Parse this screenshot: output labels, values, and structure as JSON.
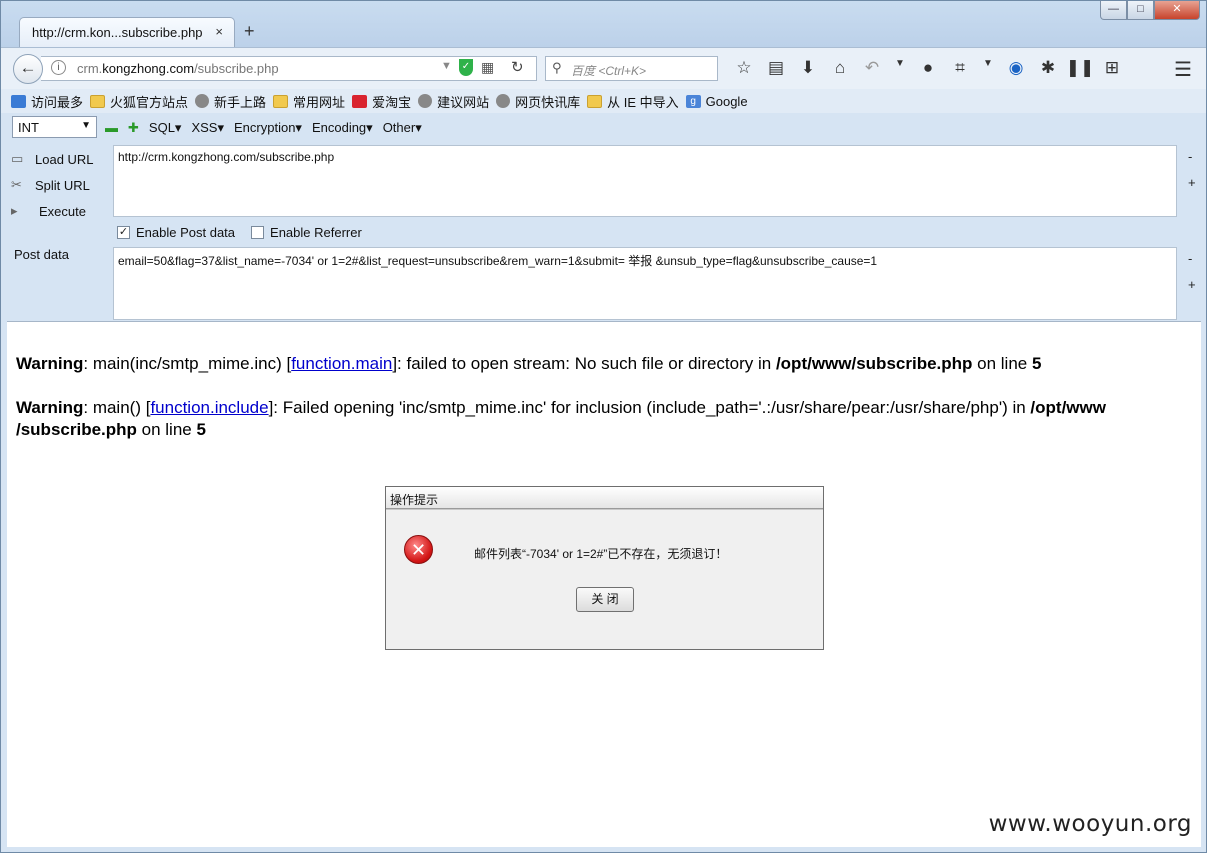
{
  "tab": {
    "title": "http://crm.kon...subscribe.php",
    "close": "×",
    "new": "+"
  },
  "window_controls": {
    "minimize": "—",
    "maximize": "□",
    "close": "✕"
  },
  "nav": {
    "back": "←",
    "url_prefix": "crm.",
    "url_host": "kongzhong.com",
    "url_path": "/subscribe.php",
    "search_placeholder": "百度 <Ctrl+K>",
    "icons": [
      "star-icon",
      "bookmarks-icon",
      "download-icon",
      "home-icon",
      "undo-icon",
      "dropdown-icon",
      "chat-icon",
      "crop-icon",
      "dropdown-icon",
      "orb-icon",
      "bug-icon",
      "footprint-icon",
      "sitemap-icon"
    ]
  },
  "bookmarks": [
    {
      "label": "访问最多",
      "icon": "blue"
    },
    {
      "label": "火狐官方站点",
      "icon": "folder"
    },
    {
      "label": "新手上路",
      "icon": "globe"
    },
    {
      "label": "常用网址",
      "icon": "folder"
    },
    {
      "label": "爱淘宝",
      "icon": "red"
    },
    {
      "label": "建议网站",
      "icon": "globe"
    },
    {
      "label": "网页快讯库",
      "icon": "globe"
    },
    {
      "label": "从 IE 中导入",
      "icon": "folder"
    },
    {
      "label": "Google",
      "icon": "google"
    }
  ],
  "hackbar": {
    "select_value": "INT",
    "menus": [
      "SQL▾",
      "XSS▾",
      "Encryption▾",
      "Encoding▾",
      "Other▾"
    ],
    "actions": [
      "Load URL",
      "Split URL",
      "Execute"
    ],
    "url_value": "http://crm.kongzhong.com/subscribe.php",
    "enable_post": "Enable Post data",
    "enable_referrer": "Enable Referrer",
    "post_label": "Post data",
    "post_value": "email=50&flag=37&list_name=-7034' or 1=2#&list_request=unsubscribe&rem_warn=1&submit= 举报 &unsub_type=flag&unsubscribe_cause=1",
    "side_minus": "-",
    "side_plus": "+"
  },
  "page": {
    "warning1": {
      "label": "Warning",
      "pre": ": main(inc/smtp_mime.inc) [",
      "link": "function.main",
      "mid": "]: failed to open stream: No such file or directory in ",
      "path": "/opt/www/subscribe.php",
      "post": " on line ",
      "line": "5"
    },
    "warning2": {
      "label": "Warning",
      "pre": ": main() [",
      "link": "function.include",
      "mid": "]: Failed opening 'inc/smtp_mime.inc' for inclusion (include_path='.:/usr/share/pear:/usr/share/php') in ",
      "path": "/opt/www /subscribe.php",
      "post": " on line ",
      "line": "5"
    },
    "dialog": {
      "title": "操作提示",
      "message": "邮件列表“-7034' or 1=2#”已不存在，无须退订！",
      "button": "关 闭"
    }
  },
  "watermark": "www.wooyun.org"
}
